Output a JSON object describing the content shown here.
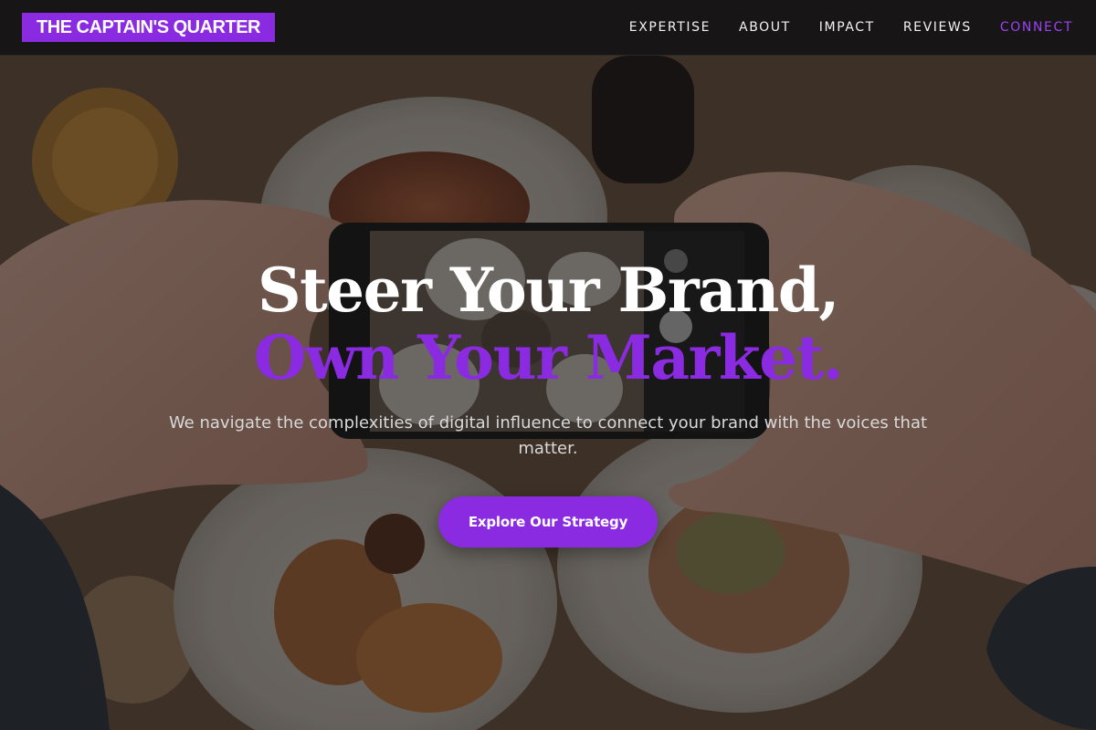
{
  "header": {
    "brand": "THE CAPTAIN'S QUARTER",
    "nav": [
      {
        "label": "EXPERTISE"
      },
      {
        "label": "ABOUT"
      },
      {
        "label": "IMPACT"
      },
      {
        "label": "REVIEWS"
      },
      {
        "label": "CONNECT"
      }
    ]
  },
  "hero": {
    "headline_line1": "Steer Your Brand,",
    "headline_line2": "Own Your Market.",
    "subtitle": "We navigate the complexities of digital influence to connect your brand with the voices that matter.",
    "cta_label": "Explore Our Strategy",
    "background_image": "hands-photographing-food-with-phone"
  },
  "colors": {
    "accent": "#8a2be2",
    "header_bg": "#171515",
    "text_light": "#ffffff"
  }
}
